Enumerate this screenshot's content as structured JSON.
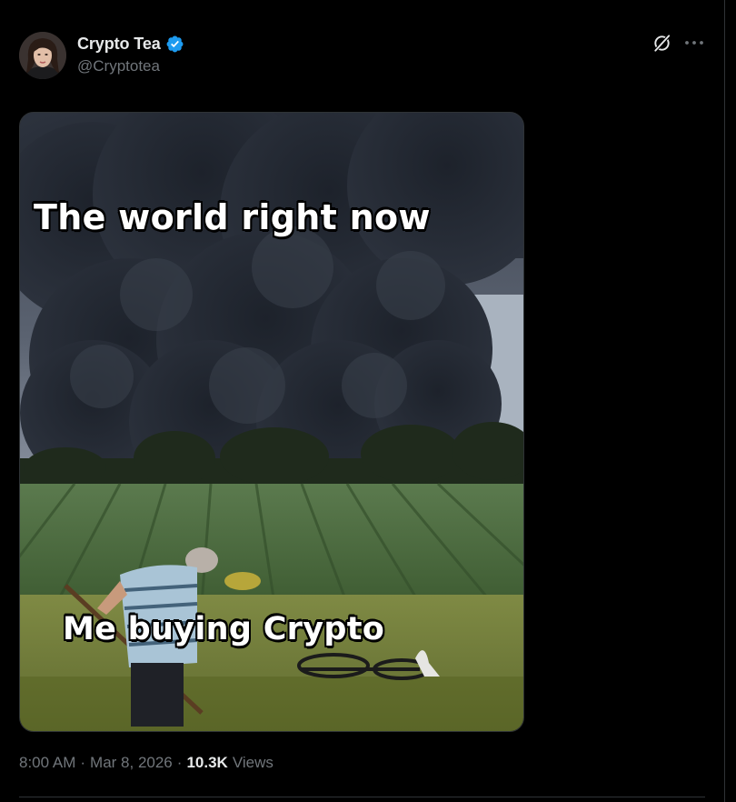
{
  "tweet": {
    "author": {
      "display_name": "Crypto Tea",
      "handle": "@Cryptotea",
      "verified": true,
      "avatar": "profile-photo"
    },
    "media": {
      "top_caption": "The world right now",
      "bottom_caption": "Me buying Crypto"
    },
    "meta": {
      "time": "8:00 AM",
      "date": "Mar 8, 2026",
      "separator": "·",
      "views_count": "10.3K",
      "views_label": "Views"
    },
    "icons": {
      "verified": "verified-badge-icon",
      "grok": "grok-icon",
      "more": "more-options-icon"
    }
  },
  "colors": {
    "background": "#000000",
    "primary_text": "#e7e9ea",
    "secondary_text": "#71767b",
    "verified_blue": "#1d9bf0",
    "divider": "#2f3336"
  }
}
